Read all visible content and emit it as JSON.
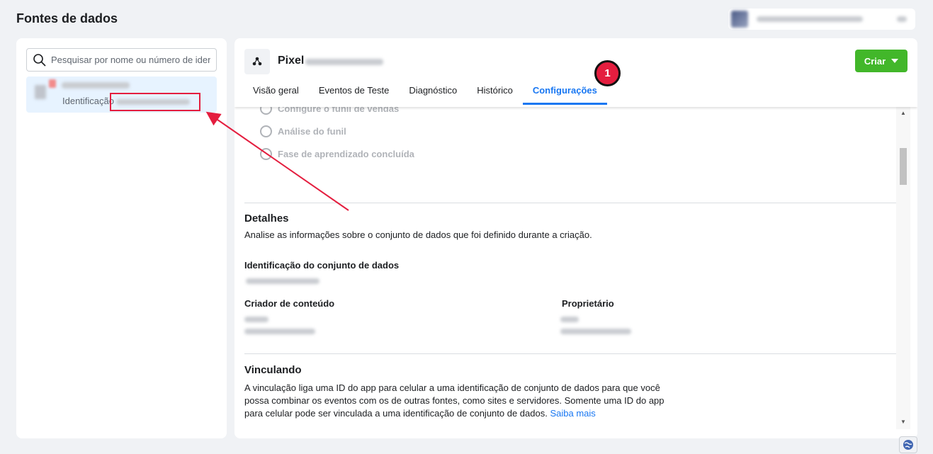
{
  "page": {
    "title": "Fontes de dados"
  },
  "search": {
    "placeholder": "Pesquisar por nome ou número de identificação"
  },
  "source_list": {
    "items": [
      {
        "id_label": "Identificação"
      }
    ]
  },
  "pixel": {
    "title": "Pixel",
    "icon": "pixel-icon"
  },
  "create_button": {
    "label": "Criar"
  },
  "tabs": [
    {
      "label": "Visão geral",
      "active": false
    },
    {
      "label": "Eventos de Teste",
      "active": false
    },
    {
      "label": "Diagnóstico",
      "active": false
    },
    {
      "label": "Histórico",
      "active": false
    },
    {
      "label": "Configurações",
      "active": true
    }
  ],
  "annotation": {
    "badge_number": "1",
    "color": "#e41e3f"
  },
  "steps": [
    {
      "label": "Configure o funil de vendas"
    },
    {
      "label": "Análise do funil"
    },
    {
      "label": "Fase de aprendizado concluída"
    }
  ],
  "details": {
    "title": "Detalhes",
    "description": "Analise as informações sobre o conjunto de dados que foi definido durante a criação.",
    "dataset_id_label": "Identificação do conjunto de dados",
    "creator_label": "Criador de conteúdo",
    "owner_label": "Proprietário"
  },
  "linking": {
    "title": "Vinculando",
    "line1": "A vinculação liga uma ID do app para celular a uma identificação de conjunto de dados para que você",
    "line2": "possa combinar os eventos com os de outras fontes, como sites e servidores. Somente uma ID do app",
    "line3": "para celular pode ser vinculada a uma identificação de conjunto de dados.",
    "link": "Saiba mais"
  },
  "colors": {
    "accent": "#1877f2",
    "create": "#42b72a",
    "highlight": "#e41e3f"
  }
}
